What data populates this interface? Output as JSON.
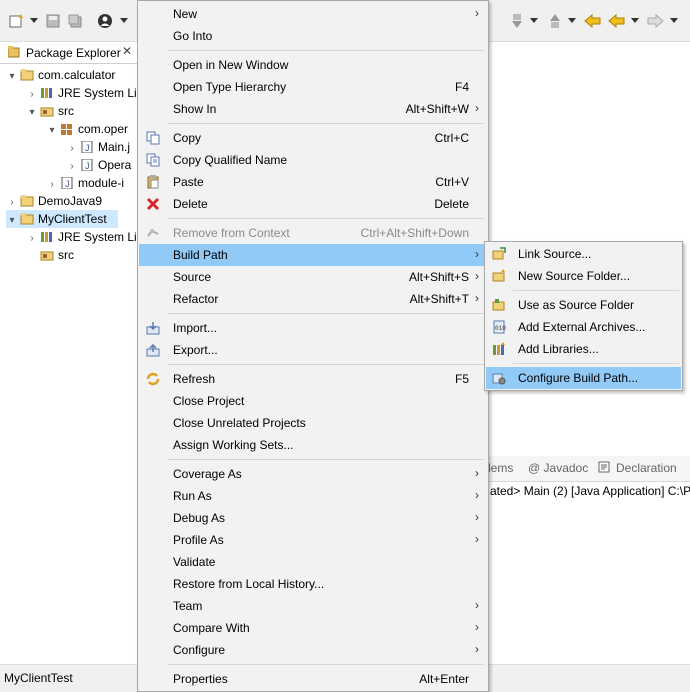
{
  "package_explorer": {
    "tab_label": "Package Explorer",
    "close_glyph": "✕",
    "tree": [
      {
        "label": "com.calculator",
        "icon": "project-icon"
      },
      {
        "label": "JRE System Li",
        "icon": "library-icon"
      },
      {
        "label": "src",
        "icon": "source-folder-icon"
      },
      {
        "label": "com.oper",
        "icon": "package-icon"
      },
      {
        "label": "Main.j",
        "icon": "java-file-icon"
      },
      {
        "label": "Opera",
        "icon": "java-file-icon"
      },
      {
        "label": "module-i",
        "icon": "java-file-icon"
      },
      {
        "label": "DemoJava9",
        "icon": "project-icon"
      },
      {
        "label": "MyClientTest",
        "icon": "project-icon"
      },
      {
        "label": "JRE System Li",
        "icon": "library-icon"
      },
      {
        "label": "src",
        "icon": "source-folder-icon"
      }
    ]
  },
  "bottom_panel": {
    "tabs": [
      "lems",
      "@ Javadoc",
      "Declaration"
    ],
    "console_line": "ated> Main (2) [Java Application] C:\\P"
  },
  "status_bar": {
    "text": "MyClientTest"
  },
  "context_menu": {
    "items": [
      {
        "label": "New",
        "accel": "",
        "submenu": true
      },
      {
        "label": "Go Into",
        "accel": "",
        "submenu": false
      },
      {
        "label": "Open in New Window",
        "accel": "",
        "submenu": false
      },
      {
        "label": "Open Type Hierarchy",
        "accel": "F4",
        "submenu": false
      },
      {
        "label": "Show In",
        "accel": "Alt+Shift+W",
        "submenu": true
      },
      {
        "label": "Copy",
        "accel": "Ctrl+C",
        "submenu": false,
        "icon": "copy-icon"
      },
      {
        "label": "Copy Qualified Name",
        "accel": "",
        "submenu": false,
        "icon": "copy-qualified-icon"
      },
      {
        "label": "Paste",
        "accel": "Ctrl+V",
        "submenu": false,
        "icon": "paste-icon"
      },
      {
        "label": "Delete",
        "accel": "Delete",
        "submenu": false,
        "icon": "delete-icon"
      },
      {
        "label": "Remove from Context",
        "accel": "Ctrl+Alt+Shift+Down",
        "submenu": false,
        "disabled": true,
        "icon": "remove-context-icon"
      },
      {
        "label": "Build Path",
        "accel": "",
        "submenu": true,
        "highlighted": true
      },
      {
        "label": "Source",
        "accel": "Alt+Shift+S",
        "submenu": true
      },
      {
        "label": "Refactor",
        "accel": "Alt+Shift+T",
        "submenu": true
      },
      {
        "label": "Import...",
        "accel": "",
        "submenu": false,
        "icon": "import-icon"
      },
      {
        "label": "Export...",
        "accel": "",
        "submenu": false,
        "icon": "export-icon"
      },
      {
        "label": "Refresh",
        "accel": "F5",
        "submenu": false,
        "icon": "refresh-icon"
      },
      {
        "label": "Close Project",
        "accel": "",
        "submenu": false
      },
      {
        "label": "Close Unrelated Projects",
        "accel": "",
        "submenu": false
      },
      {
        "label": "Assign Working Sets...",
        "accel": "",
        "submenu": false
      },
      {
        "label": "Coverage As",
        "accel": "",
        "submenu": true
      },
      {
        "label": "Run As",
        "accel": "",
        "submenu": true
      },
      {
        "label": "Debug As",
        "accel": "",
        "submenu": true
      },
      {
        "label": "Profile As",
        "accel": "",
        "submenu": true
      },
      {
        "label": "Validate",
        "accel": "",
        "submenu": false
      },
      {
        "label": "Restore from Local History...",
        "accel": "",
        "submenu": false
      },
      {
        "label": "Team",
        "accel": "",
        "submenu": true
      },
      {
        "label": "Compare With",
        "accel": "",
        "submenu": true
      },
      {
        "label": "Configure",
        "accel": "",
        "submenu": true
      },
      {
        "label": "Properties",
        "accel": "Alt+Enter",
        "submenu": false
      }
    ],
    "submenu_glyph": "›"
  },
  "build_path_submenu": {
    "items": [
      {
        "label": "Link Source...",
        "icon": "link-source-icon"
      },
      {
        "label": "New Source Folder...",
        "icon": "new-source-folder-icon"
      },
      {
        "label": "Use as Source Folder",
        "icon": "use-source-folder-icon"
      },
      {
        "label": "Add External Archives...",
        "icon": "external-archive-icon"
      },
      {
        "label": "Add Libraries...",
        "icon": "add-library-icon"
      },
      {
        "label": "Configure Build Path...",
        "icon": "configure-build-path-icon",
        "highlighted": true
      }
    ]
  },
  "colors": {
    "highlight": "#91c9f7",
    "menu_bg": "#f2f2f2",
    "tree_selection": "#cde8ff"
  }
}
